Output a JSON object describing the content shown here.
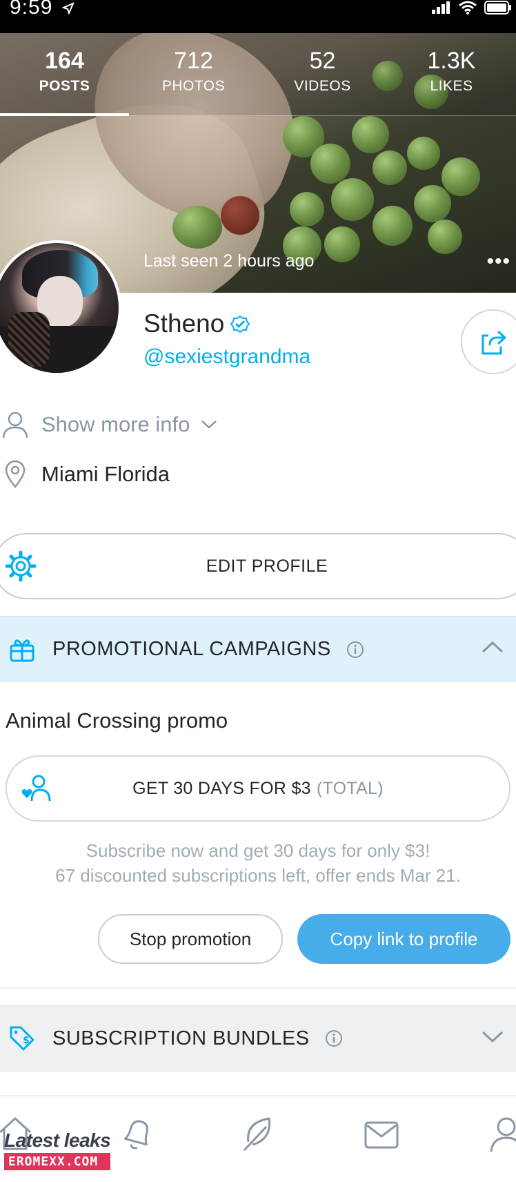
{
  "status_bar": {
    "time": "9:59"
  },
  "stats": [
    {
      "value": "164",
      "label": "POSTS",
      "active": true
    },
    {
      "value": "712",
      "label": "PHOTOS",
      "active": false
    },
    {
      "value": "52",
      "label": "VIDEOS",
      "active": false
    },
    {
      "value": "1.3K",
      "label": "LIKES",
      "active": false
    }
  ],
  "profile": {
    "last_seen": "Last seen 2 hours ago",
    "name": "Stheno",
    "username": "@sexiestgrandma",
    "show_more": "Show more info",
    "location": "Miami Florida"
  },
  "edit_profile_label": "EDIT PROFILE",
  "promotions": {
    "title": "PROMOTIONAL CAMPAIGNS",
    "promo_name": "Animal Crossing promo",
    "offer_main": "GET 30 DAYS FOR $3",
    "offer_suffix": "(TOTAL)",
    "desc_line1": "Subscribe now and get 30 days for only $3!",
    "desc_line2": "67 discounted subscriptions left, offer ends Mar 21.",
    "stop_label": "Stop promotion",
    "copy_label": "Copy link to profile"
  },
  "bundles": {
    "title": "SUBSCRIPTION BUNDLES"
  },
  "colors": {
    "accent": "#00aff0",
    "button_blue": "#46acea",
    "promo_bg": "#dff2fb"
  },
  "watermark": {
    "line1": "Latest leaks",
    "line2": "EROMEXX.COM"
  }
}
